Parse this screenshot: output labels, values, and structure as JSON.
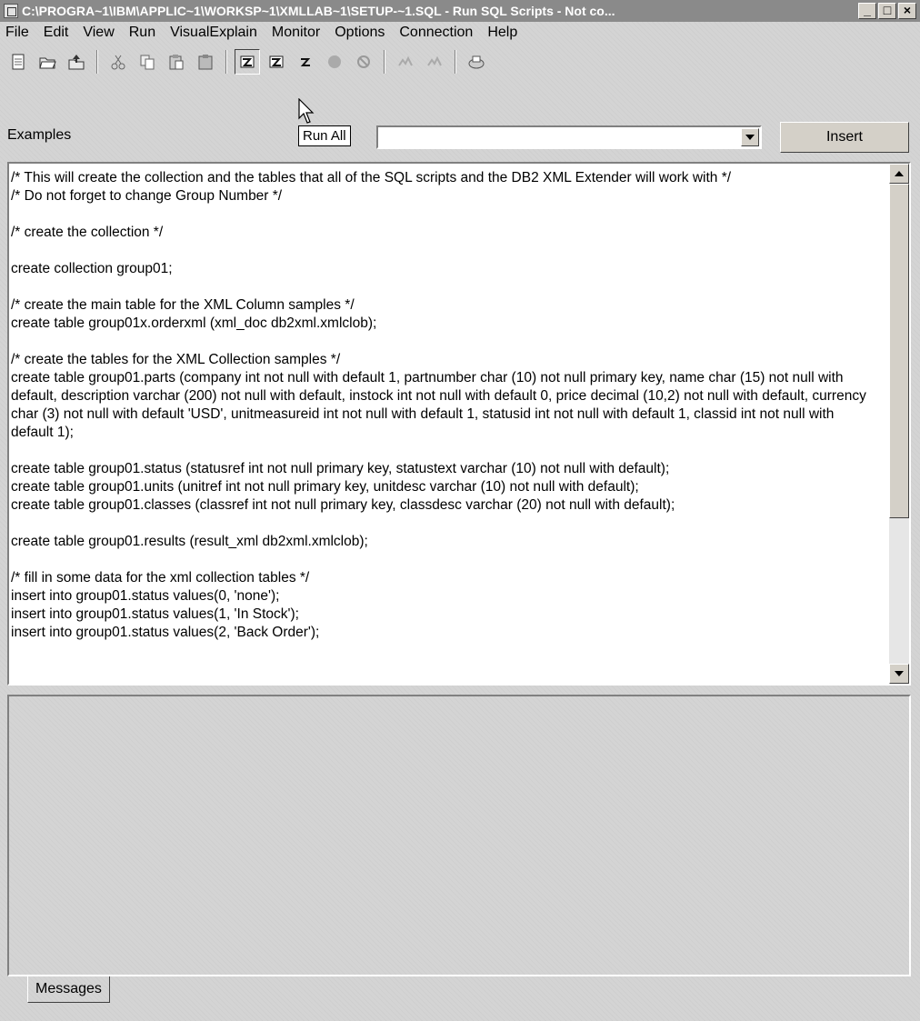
{
  "window": {
    "title": "C:\\PROGRA~1\\IBM\\APPLIC~1\\WORKSP~1\\XMLLAB~1\\SETUP-~1.SQL - Run SQL Scripts - Not co...",
    "minimize": "_",
    "maximize": "□",
    "close": "×"
  },
  "menu": {
    "items": [
      "File",
      "Edit",
      "View",
      "Run",
      "VisualExplain",
      "Monitor",
      "Options",
      "Connection",
      "Help"
    ]
  },
  "toolbar": {
    "icons": [
      "new-icon",
      "open-icon",
      "save-icon",
      "cut-icon",
      "copy-icon",
      "paste-icon",
      "paste-special-icon",
      "run-all-icon",
      "run-from-selected-icon",
      "run-selected-icon",
      "stop-icon",
      "cancel-icon",
      "explain-icon",
      "run-and-explain-icon",
      "print-icon"
    ],
    "tooltip": "Run All"
  },
  "examples": {
    "label": "Examples",
    "selected": "",
    "insert_label": "Insert"
  },
  "editor": {
    "text": "/* This will create the collection and the tables that all of the SQL scripts and the DB2 XML Extender will work with */\n/* Do not forget to change Group Number */\n\n/* create the collection */\n\ncreate collection group01;\n\n/* create the main table for the XML Column samples */\ncreate table group01x.orderxml (xml_doc db2xml.xmlclob);\n\n/* create the tables for the XML Collection samples */\ncreate table group01.parts (company int not null with default 1, partnumber char (10) not null primary key, name char (15) not null with default, description varchar (200) not null with default, instock int not null with default 0, price decimal (10,2) not null with default, currency char (3) not null with default 'USD', unitmeasureid int not null with default 1, statusid int not null with default 1, classid int not null with default 1);\n\ncreate table group01.status (statusref int not null primary key, statustext varchar (10) not null with default);\ncreate table group01.units (unitref int not null primary key, unitdesc varchar (10) not null with default);\ncreate table group01.classes (classref int not null primary key, classdesc varchar (20) not null with default);\n\ncreate table group01.results (result_xml db2xml.xmlclob);\n\n/* fill in some data for the xml collection tables */\ninsert into group01.status values(0, 'none');\ninsert into group01.status values(1, 'In Stock');\ninsert into group01.status values(2, 'Back Order');"
  },
  "messages": {
    "tab_label": "Messages"
  }
}
